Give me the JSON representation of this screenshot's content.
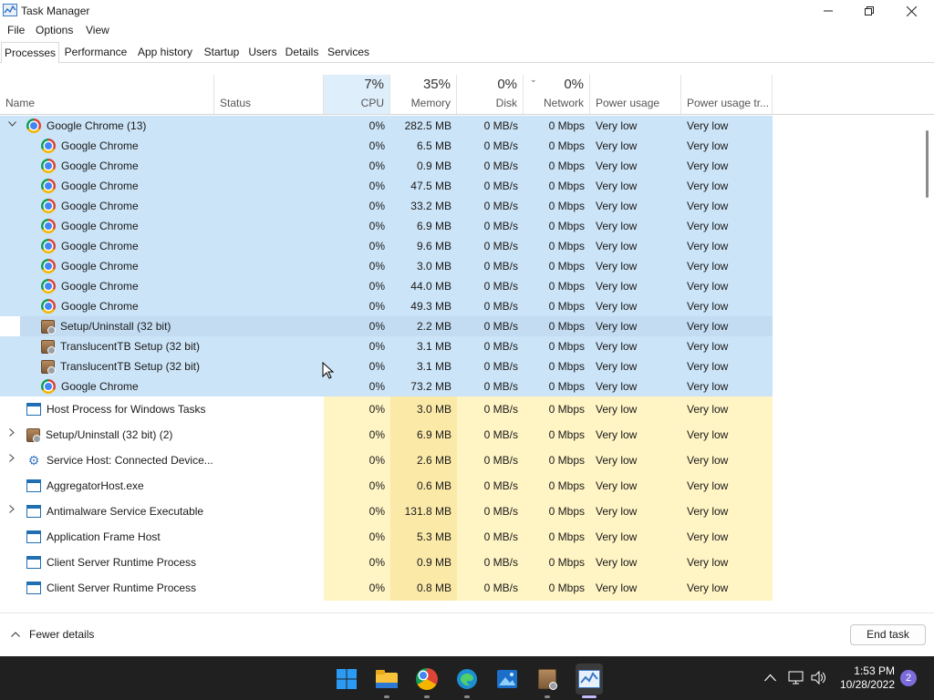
{
  "window": {
    "title": "Task Manager"
  },
  "menu": [
    "File",
    "Options",
    "View"
  ],
  "tabs": [
    "Processes",
    "Performance",
    "App history",
    "Startup",
    "Users",
    "Details",
    "Services"
  ],
  "columns": {
    "name": "Name",
    "status": "Status",
    "cpu": {
      "pct": "7%",
      "label": "CPU"
    },
    "memory": {
      "pct": "35%",
      "label": "Memory"
    },
    "disk": {
      "pct": "0%",
      "label": "Disk"
    },
    "network": {
      "pct": "0%",
      "label": "Network"
    },
    "power": "Power usage",
    "power_trend": "Power usage tr..."
  },
  "rows": [
    {
      "kind": "group",
      "name": "Google Chrome (13)",
      "icon": "chrome",
      "expander": "expanded",
      "cpu": "0%",
      "mem": "282.5 MB",
      "disk": "0 MB/s",
      "net": "0 Mbps",
      "power": "Very low",
      "trend": "Very low"
    },
    {
      "kind": "child",
      "name": "Google Chrome",
      "icon": "chrome",
      "cpu": "0%",
      "mem": "6.5 MB",
      "disk": "0 MB/s",
      "net": "0 Mbps",
      "power": "Very low",
      "trend": "Very low"
    },
    {
      "kind": "child",
      "name": "Google Chrome",
      "icon": "chrome",
      "cpu": "0%",
      "mem": "0.9 MB",
      "disk": "0 MB/s",
      "net": "0 Mbps",
      "power": "Very low",
      "trend": "Very low"
    },
    {
      "kind": "child",
      "name": "Google Chrome",
      "icon": "chrome",
      "cpu": "0%",
      "mem": "47.5 MB",
      "disk": "0 MB/s",
      "net": "0 Mbps",
      "power": "Very low",
      "trend": "Very low"
    },
    {
      "kind": "child",
      "name": "Google Chrome",
      "icon": "chrome",
      "cpu": "0%",
      "mem": "33.2 MB",
      "disk": "0 MB/s",
      "net": "0 Mbps",
      "power": "Very low",
      "trend": "Very low"
    },
    {
      "kind": "child",
      "name": "Google Chrome",
      "icon": "chrome",
      "cpu": "0%",
      "mem": "6.9 MB",
      "disk": "0 MB/s",
      "net": "0 Mbps",
      "power": "Very low",
      "trend": "Very low"
    },
    {
      "kind": "child",
      "name": "Google Chrome",
      "icon": "chrome",
      "cpu": "0%",
      "mem": "9.6 MB",
      "disk": "0 MB/s",
      "net": "0 Mbps",
      "power": "Very low",
      "trend": "Very low"
    },
    {
      "kind": "child",
      "name": "Google Chrome",
      "icon": "chrome",
      "cpu": "0%",
      "mem": "3.0 MB",
      "disk": "0 MB/s",
      "net": "0 Mbps",
      "power": "Very low",
      "trend": "Very low"
    },
    {
      "kind": "child",
      "name": "Google Chrome",
      "icon": "chrome",
      "cpu": "0%",
      "mem": "44.0 MB",
      "disk": "0 MB/s",
      "net": "0 Mbps",
      "power": "Very low",
      "trend": "Very low"
    },
    {
      "kind": "child",
      "name": "Google Chrome",
      "icon": "chrome",
      "cpu": "0%",
      "mem": "49.3 MB",
      "disk": "0 MB/s",
      "net": "0 Mbps",
      "power": "Very low",
      "trend": "Very low"
    },
    {
      "kind": "child",
      "name": "Setup/Uninstall (32 bit)",
      "icon": "box",
      "hover": true,
      "cpu": "0%",
      "mem": "2.2 MB",
      "disk": "0 MB/s",
      "net": "0 Mbps",
      "power": "Very low",
      "trend": "Very low"
    },
    {
      "kind": "child",
      "name": "TranslucentTB Setup (32 bit)",
      "icon": "box",
      "cpu": "0%",
      "mem": "3.1 MB",
      "disk": "0 MB/s",
      "net": "0 Mbps",
      "power": "Very low",
      "trend": "Very low"
    },
    {
      "kind": "child",
      "name": "TranslucentTB Setup (32 bit)",
      "icon": "box",
      "cpu": "0%",
      "mem": "3.1 MB",
      "disk": "0 MB/s",
      "net": "0 Mbps",
      "power": "Very low",
      "trend": "Very low"
    },
    {
      "kind": "child",
      "name": "Google Chrome",
      "icon": "chrome",
      "cpu": "0%",
      "mem": "73.2 MB",
      "disk": "0 MB/s",
      "net": "0 Mbps",
      "power": "Very low",
      "trend": "Very low"
    },
    {
      "kind": "proc",
      "name": "Host Process for Windows Tasks",
      "icon": "win",
      "cpu": "0%",
      "mem": "3.0 MB",
      "disk": "0 MB/s",
      "net": "0 Mbps",
      "power": "Very low",
      "trend": "Very low"
    },
    {
      "kind": "proc",
      "name": "Setup/Uninstall (32 bit) (2)",
      "icon": "box",
      "expander": "collapsed",
      "cpu": "0%",
      "mem": "6.9 MB",
      "disk": "0 MB/s",
      "net": "0 Mbps",
      "power": "Very low",
      "trend": "Very low"
    },
    {
      "kind": "proc",
      "name": "Service Host: Connected Device...",
      "icon": "gear",
      "expander": "collapsed",
      "cpu": "0%",
      "mem": "2.6 MB",
      "disk": "0 MB/s",
      "net": "0 Mbps",
      "power": "Very low",
      "trend": "Very low"
    },
    {
      "kind": "proc",
      "name": "AggregatorHost.exe",
      "icon": "win",
      "cpu": "0%",
      "mem": "0.6 MB",
      "disk": "0 MB/s",
      "net": "0 Mbps",
      "power": "Very low",
      "trend": "Very low"
    },
    {
      "kind": "proc",
      "name": "Antimalware Service Executable",
      "icon": "win",
      "expander": "collapsed",
      "cpu": "0%",
      "mem": "131.8 MB",
      "disk": "0 MB/s",
      "net": "0 Mbps",
      "power": "Very low",
      "trend": "Very low"
    },
    {
      "kind": "proc",
      "name": "Application Frame Host",
      "icon": "win",
      "cpu": "0%",
      "mem": "5.3 MB",
      "disk": "0 MB/s",
      "net": "0 Mbps",
      "power": "Very low",
      "trend": "Very low"
    },
    {
      "kind": "proc",
      "name": "Client Server Runtime Process",
      "icon": "win",
      "cpu": "0%",
      "mem": "0.9 MB",
      "disk": "0 MB/s",
      "net": "0 Mbps",
      "power": "Very low",
      "trend": "Very low"
    },
    {
      "kind": "proc",
      "name": "Client Server Runtime Process",
      "icon": "win",
      "cpu": "0%",
      "mem": "0.8 MB",
      "disk": "0 MB/s",
      "net": "0 Mbps",
      "power": "Very low",
      "trend": "Very low"
    }
  ],
  "footer": {
    "fewer_details": "Fewer details",
    "end_task": "End task"
  },
  "taskbar": {
    "apps": [
      "start-icon",
      "file-explorer-icon",
      "chrome-icon",
      "edge-icon",
      "photos-icon",
      "setup-icon",
      "task-manager-icon"
    ],
    "time": "1:53 PM",
    "date": "10/28/2022",
    "notifications": "2"
  },
  "colors": {
    "selected_bg": "#cce4f7",
    "heat_light": "#fff4c4",
    "heat_mem": "#fbe9a8",
    "taskbar": "#202020"
  }
}
